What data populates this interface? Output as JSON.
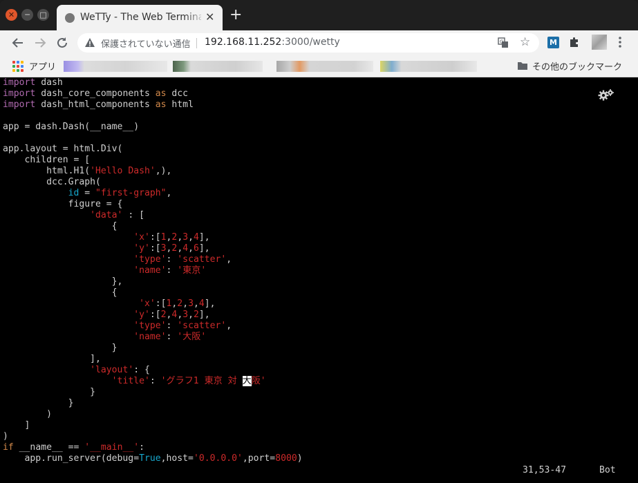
{
  "window": {
    "tab_title": "WeTTy - The Web Terminal",
    "new_tab_label": "+"
  },
  "toolbar": {
    "security_label": "保護されていない通信",
    "url_host": "192.168.11.252",
    "url_path": ":3000/wetty",
    "extension_m_label": "M"
  },
  "bookmarks": {
    "apps_label": "アプリ",
    "other_label": "その他のブックマーク"
  },
  "terminal": {
    "lines": [
      [
        {
          "t": "import",
          "c": "kw"
        },
        {
          "t": " dash"
        }
      ],
      [
        {
          "t": "import",
          "c": "kw"
        },
        {
          "t": " dash_core_components "
        },
        {
          "t": "as",
          "c": "op"
        },
        {
          "t": " dcc"
        }
      ],
      [
        {
          "t": "import",
          "c": "kw"
        },
        {
          "t": " dash_html_components "
        },
        {
          "t": "as",
          "c": "op"
        },
        {
          "t": " html"
        }
      ],
      [],
      [
        {
          "t": "app = dash.Dash(__name__)"
        }
      ],
      [],
      [
        {
          "t": "app.layout = html.Div("
        }
      ],
      [
        {
          "t": "    children = ["
        }
      ],
      [
        {
          "t": "        html.H1("
        },
        {
          "t": "'Hello Dash'",
          "c": "str"
        },
        {
          "t": ",),"
        }
      ],
      [
        {
          "t": "        dcc.Graph("
        }
      ],
      [
        {
          "t": "            "
        },
        {
          "t": "id",
          "c": "attr"
        },
        {
          "t": " = "
        },
        {
          "t": "\"first-graph\"",
          "c": "str"
        },
        {
          "t": ","
        }
      ],
      [
        {
          "t": "            figure = {"
        }
      ],
      [
        {
          "t": "                "
        },
        {
          "t": "'data'",
          "c": "str"
        },
        {
          "t": " : ["
        }
      ],
      [
        {
          "t": "                    {"
        }
      ],
      [
        {
          "t": "                        "
        },
        {
          "t": "'x'",
          "c": "str"
        },
        {
          "t": ":["
        },
        {
          "t": "1",
          "c": "num"
        },
        {
          "t": ","
        },
        {
          "t": "2",
          "c": "num"
        },
        {
          "t": ","
        },
        {
          "t": "3",
          "c": "num"
        },
        {
          "t": ","
        },
        {
          "t": "4",
          "c": "num"
        },
        {
          "t": "],"
        }
      ],
      [
        {
          "t": "                        "
        },
        {
          "t": "'y'",
          "c": "str"
        },
        {
          "t": ":["
        },
        {
          "t": "3",
          "c": "num"
        },
        {
          "t": ","
        },
        {
          "t": "2",
          "c": "num"
        },
        {
          "t": ","
        },
        {
          "t": "4",
          "c": "num"
        },
        {
          "t": ","
        },
        {
          "t": "6",
          "c": "num"
        },
        {
          "t": "],"
        }
      ],
      [
        {
          "t": "                        "
        },
        {
          "t": "'type'",
          "c": "str"
        },
        {
          "t": ": "
        },
        {
          "t": "'scatter'",
          "c": "str"
        },
        {
          "t": ","
        }
      ],
      [
        {
          "t": "                        "
        },
        {
          "t": "'name'",
          "c": "str"
        },
        {
          "t": ": "
        },
        {
          "t": "'東京'",
          "c": "str"
        }
      ],
      [
        {
          "t": "                    },"
        }
      ],
      [
        {
          "t": "                    {"
        }
      ],
      [
        {
          "t": "                         "
        },
        {
          "t": "'x'",
          "c": "str"
        },
        {
          "t": ":["
        },
        {
          "t": "1",
          "c": "num"
        },
        {
          "t": ","
        },
        {
          "t": "2",
          "c": "num"
        },
        {
          "t": ","
        },
        {
          "t": "3",
          "c": "num"
        },
        {
          "t": ","
        },
        {
          "t": "4",
          "c": "num"
        },
        {
          "t": "],"
        }
      ],
      [
        {
          "t": "                        "
        },
        {
          "t": "'y'",
          "c": "str"
        },
        {
          "t": ":["
        },
        {
          "t": "2",
          "c": "num"
        },
        {
          "t": ","
        },
        {
          "t": "4",
          "c": "num"
        },
        {
          "t": ","
        },
        {
          "t": "3",
          "c": "num"
        },
        {
          "t": ","
        },
        {
          "t": "2",
          "c": "num"
        },
        {
          "t": "],"
        }
      ],
      [
        {
          "t": "                        "
        },
        {
          "t": "'type'",
          "c": "str"
        },
        {
          "t": ": "
        },
        {
          "t": "'scatter'",
          "c": "str"
        },
        {
          "t": ","
        }
      ],
      [
        {
          "t": "                        "
        },
        {
          "t": "'name'",
          "c": "str"
        },
        {
          "t": ": "
        },
        {
          "t": "'大阪'",
          "c": "str"
        }
      ],
      [
        {
          "t": "                    }"
        }
      ],
      [
        {
          "t": "                ],"
        }
      ],
      [
        {
          "t": "                "
        },
        {
          "t": "'layout'",
          "c": "str"
        },
        {
          "t": ": {"
        }
      ],
      [
        {
          "t": "                    "
        },
        {
          "t": "'title'",
          "c": "str"
        },
        {
          "t": ": "
        },
        {
          "t": "'グラフ1 東京 対 ",
          "c": "str"
        },
        {
          "t": "大",
          "c": "cursor"
        },
        {
          "t": "阪'",
          "c": "str"
        }
      ],
      [
        {
          "t": "                }"
        }
      ],
      [
        {
          "t": "            }"
        }
      ],
      [
        {
          "t": "        )"
        }
      ],
      [
        {
          "t": "    ]"
        }
      ],
      [
        {
          "t": ")"
        }
      ],
      [
        {
          "t": "if",
          "c": "op"
        },
        {
          "t": " __name__ == "
        },
        {
          "t": "'__main__'",
          "c": "str"
        },
        {
          "t": ":"
        }
      ],
      [
        {
          "t": "    app.run_server(debug="
        },
        {
          "t": "True",
          "c": "attr"
        },
        {
          "t": ",host="
        },
        {
          "t": "'0.0.0.0'",
          "c": "str"
        },
        {
          "t": ",port="
        },
        {
          "t": "8000",
          "c": "num"
        },
        {
          "t": ")"
        }
      ]
    ],
    "status_position": "31,53-47",
    "status_scroll": "Bot"
  },
  "colors": {
    "keyword": "#b06ab0",
    "operator": "#d0884a",
    "string": "#cd2a2a",
    "attribute": "#17a8cd",
    "foreground": "#d0d0d0",
    "background": "#000000"
  },
  "icons": [
    "close-icon",
    "minimize-icon",
    "maximize-icon",
    "globe-icon",
    "tab-close-icon",
    "back-arrow-icon",
    "forward-arrow-icon",
    "reload-icon",
    "warning-icon",
    "translate-icon",
    "star-icon",
    "puzzle-icon",
    "menu-dots-icon",
    "apps-icon",
    "folder-icon",
    "gear-icon"
  ]
}
